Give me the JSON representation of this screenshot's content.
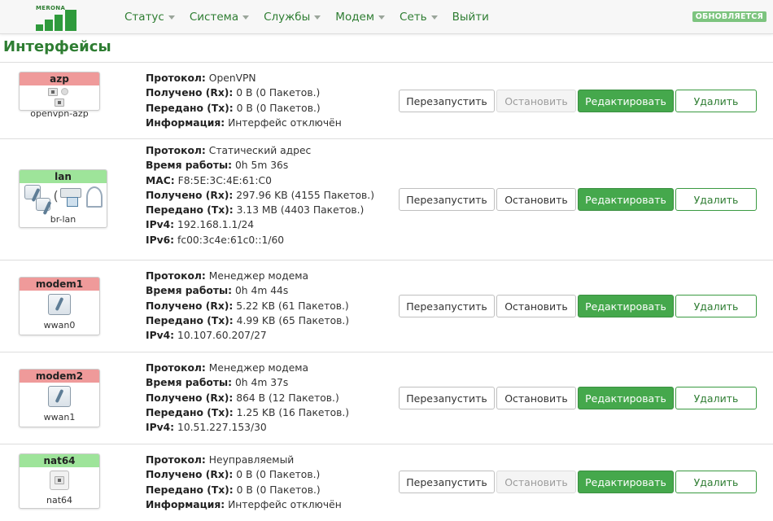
{
  "header": {
    "logo_text": "MERONA",
    "nav": [
      {
        "label": "Статус",
        "dropdown": true
      },
      {
        "label": "Система",
        "dropdown": true
      },
      {
        "label": "Службы",
        "dropdown": true
      },
      {
        "label": "Модем",
        "dropdown": true
      },
      {
        "label": "Сеть",
        "dropdown": true
      },
      {
        "label": "Выйти",
        "dropdown": false
      }
    ],
    "update_badge": "ОБНОВЛЯЕТСЯ"
  },
  "page": {
    "title": "Интерфейсы"
  },
  "buttons": {
    "restart": "Перезапустить",
    "stop": "Остановить",
    "edit": "Редактировать",
    "delete": "Удалить"
  },
  "colors": {
    "accent": "#2e7d32",
    "edit_bg": "#45a84c",
    "down": "#ef9a9a",
    "up": "#9ee49a"
  },
  "interfaces": [
    {
      "name": "azp",
      "device": "openvpn-azp",
      "status": "down",
      "stop_disabled": true,
      "lines": [
        {
          "label": "Протокол:",
          "value": "OpenVPN"
        },
        {
          "label": "Получено (Rx):",
          "value": "0 B (0 Пакетов.)"
        },
        {
          "label": "Передано (Tx):",
          "value": "0 B (0 Пакетов.)"
        },
        {
          "label": "Информация:",
          "value": "Интерфейс отключён"
        }
      ]
    },
    {
      "name": "lan",
      "device": "br-lan",
      "status": "up",
      "stop_disabled": false,
      "lines": [
        {
          "label": "Протокол:",
          "value": "Статический адрес"
        },
        {
          "label": "Время работы:",
          "value": "0h 5m 36s"
        },
        {
          "label": "MAC:",
          "value": "F8:5E:3C:4E:61:C0"
        },
        {
          "label": "Получено (Rx):",
          "value": "297.96 KB (4155 Пакетов.)"
        },
        {
          "label": "Передано (Tx):",
          "value": "3.13 MB (4403 Пакетов.)"
        },
        {
          "label": "IPv4:",
          "value": "192.168.1.1/24"
        },
        {
          "label": "IPv6:",
          "value": "fc00:3c4e:61c0::1/60"
        }
      ]
    },
    {
      "name": "modem1",
      "device": "wwan0",
      "status": "down",
      "stop_disabled": false,
      "lines": [
        {
          "label": "Протокол:",
          "value": "Менеджер модема"
        },
        {
          "label": "Время работы:",
          "value": "0h 4m 44s"
        },
        {
          "label": "Получено (Rx):",
          "value": "5.22 KB (61 Пакетов.)"
        },
        {
          "label": "Передано (Tx):",
          "value": "4.99 KB (65 Пакетов.)"
        },
        {
          "label": "IPv4:",
          "value": "10.107.60.207/27"
        }
      ]
    },
    {
      "name": "modem2",
      "device": "wwan1",
      "status": "down",
      "stop_disabled": false,
      "lines": [
        {
          "label": "Протокол:",
          "value": "Менеджер модема"
        },
        {
          "label": "Время работы:",
          "value": "0h 4m 37s"
        },
        {
          "label": "Получено (Rx):",
          "value": "864 B (12 Пакетов.)"
        },
        {
          "label": "Передано (Tx):",
          "value": "1.25 KB (16 Пакетов.)"
        },
        {
          "label": "IPv4:",
          "value": "10.51.227.153/30"
        }
      ]
    },
    {
      "name": "nat64",
      "device": "nat64",
      "status": "up",
      "stop_disabled": true,
      "lines": [
        {
          "label": "Протокол:",
          "value": "Неуправляемый"
        },
        {
          "label": "Получено (Rx):",
          "value": "0 B (0 Пакетов.)"
        },
        {
          "label": "Передано (Tx):",
          "value": "0 B (0 Пакетов.)"
        },
        {
          "label": "Информация:",
          "value": "Интерфейс отключён"
        }
      ]
    }
  ]
}
